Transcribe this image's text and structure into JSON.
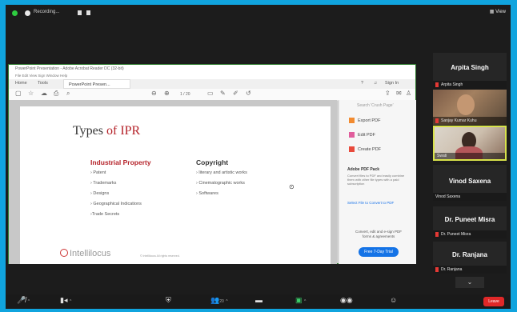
{
  "topbar": {
    "recording_label": "Recording...",
    "view_label": "View"
  },
  "pdf": {
    "window_title": "PowerPoint Presentation - Adobe Acrobat Reader DC (32-bit)",
    "menu": "File  Edit  View  Sign  Window  Help",
    "tabs": {
      "home": "Home",
      "tools": "Tools",
      "document": "PowerPoint Presen...",
      "sign_in": "Sign In"
    },
    "page_indicator": "1 / 20"
  },
  "slide": {
    "title_prefix": "Types ",
    "title_highlight": "of IPR",
    "left_heading": "Industrial Property",
    "left_items": [
      "Patent",
      "Trademarks",
      "Designs",
      "Geographical Indications",
      "Trade Secrets"
    ],
    "right_heading": "Copyright",
    "right_items": [
      "literary and artistic works",
      "Cinematographic works",
      "Softwares"
    ],
    "logo_text": "Intellilocus",
    "footer": "© Intellilocus All rights reserved."
  },
  "acrobat_panel": {
    "search_placeholder": "Search 'Crush Page'",
    "items": [
      "Export PDF",
      "Edit PDF",
      "Create PDF"
    ],
    "pack_heading": "Adobe PDF Pack",
    "pack_text": "Convert files to PDF and easily combine them with other file types with a paid subscription",
    "select_link": "Select File to Convert to PDF",
    "bottom_text": "Convert, edit and e-sign PDF forms & agreements",
    "cta": "Free 7-Day Trial"
  },
  "participants": [
    {
      "name": "Arpita Singh",
      "label": "Arpita Singh"
    },
    {
      "label": "Sanjay Kumar Kuhu"
    },
    {
      "label": "Swati"
    },
    {
      "name": "Vinod Saxena",
      "label": "Vinod Saxena"
    },
    {
      "name": "Dr. Puneet Misra",
      "label": "Dr. Puneet Misra"
    },
    {
      "name": "Dr. Ranjana",
      "label": "Dr. Ranjana"
    }
  ],
  "toolbar": {
    "participants_count": "20",
    "leave": "Leave"
  },
  "colors": {
    "accent_red": "#b5232a",
    "leave_red": "#e02828",
    "frame_blue": "#10a4de",
    "speaker_border": "#d8e24a"
  }
}
